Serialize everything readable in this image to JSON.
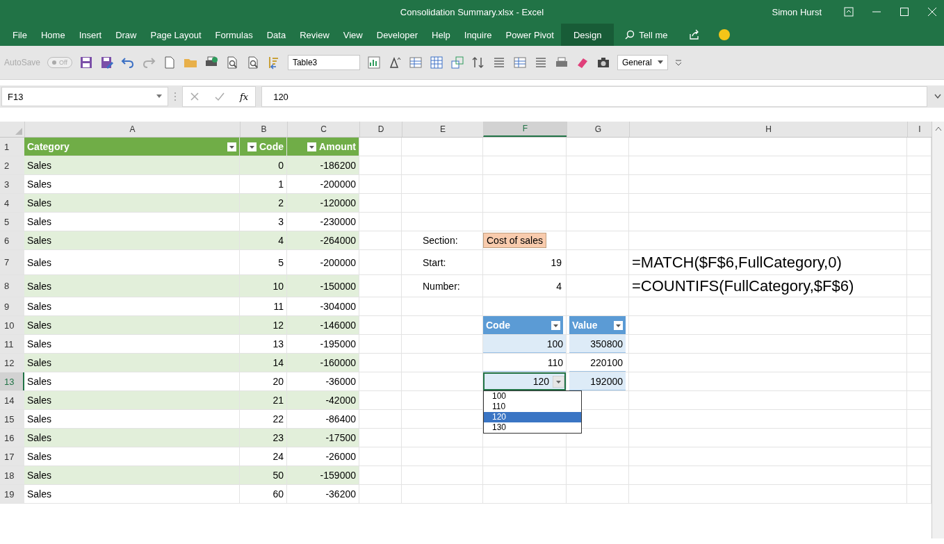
{
  "window": {
    "title": "Consolidation Summary.xlsx  -  Excel",
    "user": "Simon Hurst"
  },
  "ribbon_tabs": [
    {
      "label": "File",
      "selected": false
    },
    {
      "label": "Home",
      "selected": false
    },
    {
      "label": "Insert",
      "selected": false
    },
    {
      "label": "Draw",
      "selected": false
    },
    {
      "label": "Page Layout",
      "selected": false
    },
    {
      "label": "Formulas",
      "selected": false
    },
    {
      "label": "Data",
      "selected": false
    },
    {
      "label": "Review",
      "selected": false
    },
    {
      "label": "View",
      "selected": false
    },
    {
      "label": "Developer",
      "selected": false
    },
    {
      "label": "Help",
      "selected": false
    },
    {
      "label": "Inquire",
      "selected": false
    },
    {
      "label": "Power Pivot",
      "selected": false
    },
    {
      "label": "Design",
      "selected": true
    }
  ],
  "tell_me": "Tell me",
  "quick_access": {
    "autosave_label": "AutoSave",
    "autosave": {
      "on": false,
      "label": "Off"
    },
    "table_name": "Table3",
    "number_format": "General"
  },
  "formula_bar": {
    "name_box": "F13",
    "fx": "fx",
    "formula": "120"
  },
  "columns": [
    {
      "label": "A",
      "selected": false
    },
    {
      "label": "B",
      "selected": false
    },
    {
      "label": "C",
      "selected": false
    },
    {
      "label": "D",
      "selected": false
    },
    {
      "label": "E",
      "selected": false
    },
    {
      "label": "F",
      "selected": true
    },
    {
      "label": "G",
      "selected": false
    },
    {
      "label": "H",
      "selected": false
    },
    {
      "label": "I",
      "selected": false
    }
  ],
  "row_numbers": [
    {
      "label": "1",
      "selected": false
    },
    {
      "label": "2",
      "selected": false
    },
    {
      "label": "3",
      "selected": false
    },
    {
      "label": "4",
      "selected": false
    },
    {
      "label": "5",
      "selected": false
    },
    {
      "label": "6",
      "selected": false
    },
    {
      "label": "7",
      "selected": false
    },
    {
      "label": "8",
      "selected": false
    },
    {
      "label": "9",
      "selected": false
    },
    {
      "label": "10",
      "selected": false
    },
    {
      "label": "11",
      "selected": false
    },
    {
      "label": "12",
      "selected": false
    },
    {
      "label": "13",
      "selected": true
    },
    {
      "label": "14",
      "selected": false
    },
    {
      "label": "15",
      "selected": false
    },
    {
      "label": "16",
      "selected": false
    },
    {
      "label": "17",
      "selected": false
    },
    {
      "label": "18",
      "selected": false
    },
    {
      "label": "19",
      "selected": false
    }
  ],
  "category_table": {
    "columns": [
      "Category",
      "Code",
      "Amount"
    ],
    "rows": [
      [
        "Sales",
        "0",
        "-186200"
      ],
      [
        "Sales",
        "1",
        "-200000"
      ],
      [
        "Sales",
        "2",
        "-120000"
      ],
      [
        "Sales",
        "3",
        "-230000"
      ],
      [
        "Sales",
        "4",
        "-264000"
      ],
      [
        "Sales",
        "5",
        "-200000"
      ],
      [
        "Sales",
        "10",
        "-150000"
      ],
      [
        "Sales",
        "11",
        "-304000"
      ],
      [
        "Sales",
        "12",
        "-146000"
      ],
      [
        "Sales",
        "13",
        "-195000"
      ],
      [
        "Sales",
        "14",
        "-160000"
      ],
      [
        "Sales",
        "20",
        "-36000"
      ],
      [
        "Sales",
        "21",
        "-42000"
      ],
      [
        "Sales",
        "22",
        "-86400"
      ],
      [
        "Sales",
        "23",
        "-17500"
      ],
      [
        "Sales",
        "24",
        "-26000"
      ],
      [
        "Sales",
        "50",
        "-159000"
      ],
      [
        "Sales",
        "60",
        "-36200"
      ]
    ]
  },
  "parameters": [
    {
      "label": "Section:",
      "value": "Cost of sales",
      "kind": "input"
    },
    {
      "label": "Start:",
      "value": "19",
      "kind": "number"
    },
    {
      "label": "Number:",
      "value": "4",
      "kind": "number"
    }
  ],
  "formulas": [
    "=MATCH($F$6,FullCategory,0)",
    "=COUNTIFS(FullCategory,$F$6)"
  ],
  "lookup_table": {
    "columns": [
      "Code",
      "Value"
    ],
    "rows": [
      [
        "100",
        "350800"
      ],
      [
        "110",
        "220100"
      ],
      [
        "120",
        "192000"
      ]
    ]
  },
  "dropdown": [
    {
      "label": "100",
      "selected": false
    },
    {
      "label": "110",
      "selected": false
    },
    {
      "label": "120",
      "selected": true
    },
    {
      "label": "130",
      "selected": false
    }
  ]
}
